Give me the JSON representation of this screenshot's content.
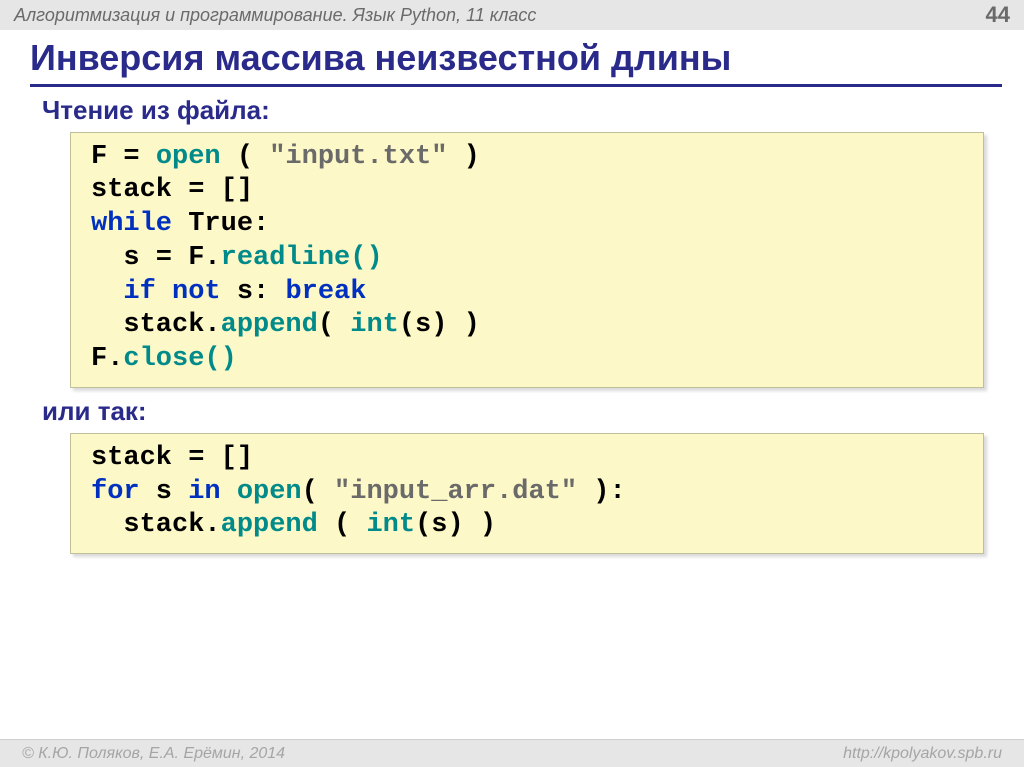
{
  "header": {
    "left": "Алгоритмизация и программирование. Язык Python, 11 класс",
    "right": "44"
  },
  "title": "Инверсия массива неизвестной длины",
  "section1": {
    "heading": "Чтение из файла:",
    "code": {
      "l1a": "F = ",
      "l1b": "open",
      "l1c": " ( ",
      "l1d": "\"input.txt\"",
      "l1e": " )",
      "l2": "stack = []",
      "l3a": "while",
      "l3b": " True:",
      "l4a": "  s = F.",
      "l4b": "readline()",
      "l5a": "  ",
      "l5b": "if not",
      "l5c": " s: ",
      "l5d": "break",
      "l6a": "  stack.",
      "l6b": "append",
      "l6c": "( ",
      "l6d": "int",
      "l6e": "(s) )",
      "l7a": "F.",
      "l7b": "close()"
    }
  },
  "section2": {
    "heading": "или так:",
    "code": {
      "l1": "stack = []",
      "l2a": "for",
      "l2b": " s ",
      "l2c": "in",
      "l2d": " ",
      "l2e": "open",
      "l2f": "( ",
      "l2g": "\"input_arr.dat\"",
      "l2h": " ):",
      "l3a": "  stack.",
      "l3b": "append",
      "l3c": " ( ",
      "l3d": "int",
      "l3e": "(s) )"
    }
  },
  "footer": {
    "left": "© К.Ю. Поляков, Е.А. Ерёмин, 2014",
    "right": "http://kpolyakov.spb.ru"
  }
}
